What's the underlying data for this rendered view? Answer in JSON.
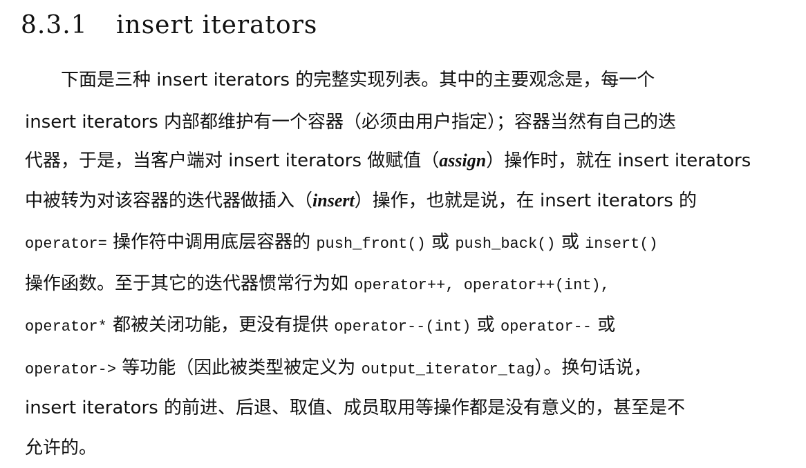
{
  "section": {
    "number": "8.3.1",
    "title": "insert iterators"
  },
  "paragraph": {
    "l1": {
      "a": "下面是三种 insert iterators 的完整实现列表。其中的主要观念是，每一个"
    },
    "l2": {
      "a": "insert iterators 内部都维护有一个容器（必须由用户指定）；容器当然有自己的迭"
    },
    "l3": {
      "a": "代器，于是，当客户端对 insert iterators 做赋值（",
      "b": "assign",
      "c": "）操作时，就在 insert iterators"
    },
    "l4": {
      "a": "中被转为对该容器的迭代器做插入（",
      "b": "insert",
      "c": "）操作，也就是说，在 insert iterators 的"
    },
    "l5": {
      "a": "operator=",
      "b": " 操作符中调用底层容器的 ",
      "c": "push_front()",
      "d": " 或 ",
      "e": "push_back()",
      "f": " 或 ",
      "g": "insert()"
    },
    "l6": {
      "a": "操作函数。至于其它的迭代器惯常行为如 ",
      "b": "operator++, operator++(int),"
    },
    "l7": {
      "a": "operator*",
      "b": " 都被关闭功能，更没有提供 ",
      "c": "operator--(int)",
      "d": " 或 ",
      "e": "operator--",
      "f": " 或"
    },
    "l8": {
      "a": "operator->",
      "b": " 等功能（因此被类型被定义为 ",
      "c": "output_iterator_tag",
      "d": "）。换句话说，"
    },
    "l9": {
      "a": "insert iterators 的前进、后退、取值、成员取用等操作都是没有意义的，甚至是不"
    },
    "l10": {
      "a": "允许的。"
    }
  }
}
